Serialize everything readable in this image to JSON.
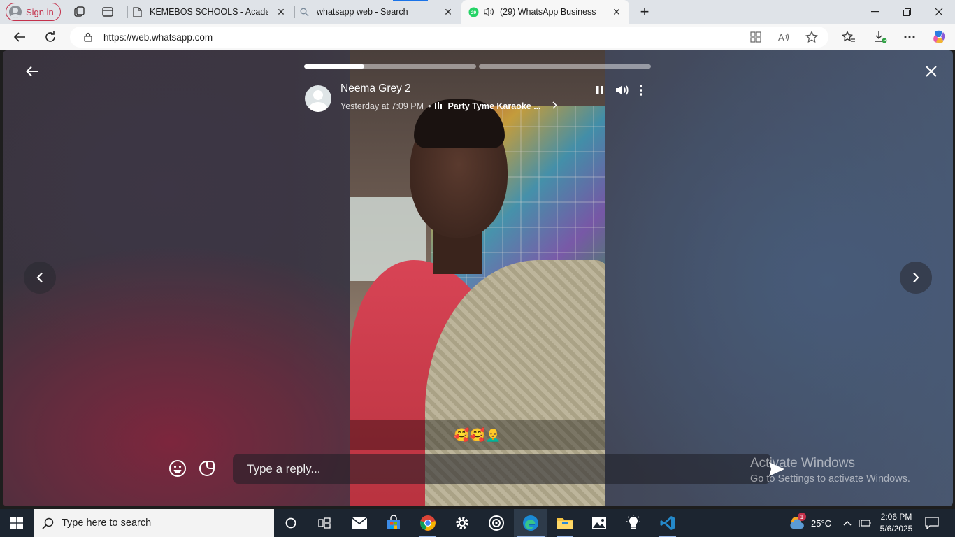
{
  "browser": {
    "signin_label": "Sign in",
    "tabs": [
      {
        "title": "KEMEBOS SCHOOLS - Academic I",
        "icon": "document-icon"
      },
      {
        "title": "whatsapp web - Search",
        "icon": "search-icon"
      },
      {
        "title": "(29) WhatsApp Business",
        "icon": "whatsapp-icon",
        "badge": "29",
        "active": true
      }
    ],
    "url": "https://web.whatsapp.com"
  },
  "status": {
    "contact_name": "Neema Grey 2",
    "timestamp": "Yesterday at 7:09 PM",
    "separator": "•",
    "music_title": "Party Tyme Karaoke ...",
    "progress": [
      0.35,
      0.0
    ],
    "caption": "🥰🥰👨‍🦲",
    "reply_placeholder": "Type a reply..."
  },
  "watermark": {
    "line1": "Activate Windows",
    "line2": "Go to Settings to activate Windows."
  },
  "taskbar": {
    "search_placeholder": "Type here to search",
    "weather_temp": "25°C",
    "weather_badge": "1",
    "time": "2:06 PM",
    "date": "5/6/2025"
  },
  "colors": {
    "whatsapp_green": "#25d366",
    "signin_red": "#c4314b",
    "taskbar_bg": "#1c2530"
  }
}
